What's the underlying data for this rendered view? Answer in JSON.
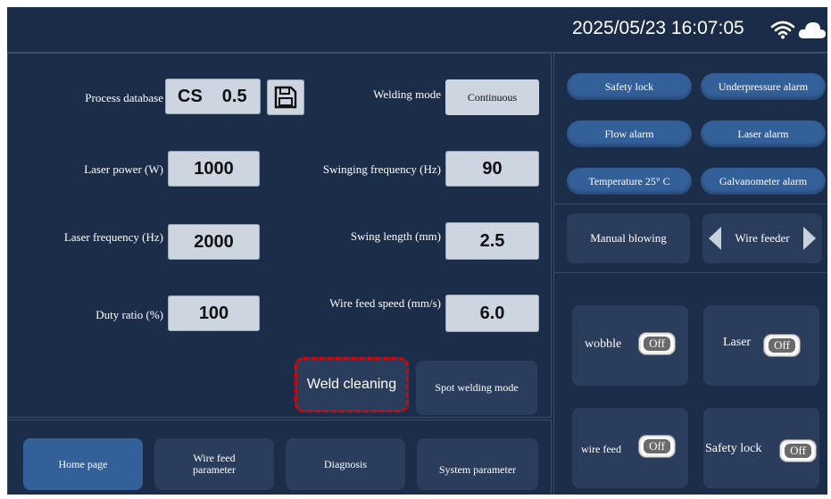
{
  "header": {
    "datetime": "2025/05/23 16:07:05",
    "wifi_icon": "wifi-icon",
    "cloud_icon": "cloud-icon"
  },
  "params": {
    "process_database": {
      "label": "Process database",
      "code": "CS",
      "value": "0.5"
    },
    "laser_power": {
      "label": "Laser power (W)",
      "value": "1000"
    },
    "laser_frequency": {
      "label": "Laser frequency (Hz)",
      "value": "2000"
    },
    "duty_ratio": {
      "label": "Duty ratio (%)",
      "value": "100"
    },
    "welding_mode": {
      "label": "Welding mode",
      "value": "Continuous"
    },
    "swinging_frequency": {
      "label": "Swinging frequency (Hz)",
      "value": "90"
    },
    "swing_length": {
      "label": "Swing length (mm)",
      "value": "2.5"
    },
    "wire_feed_speed": {
      "label": "Wire feed speed (mm/s)",
      "value": "6.0"
    }
  },
  "actions": {
    "weld_cleaning": "Weld cleaning",
    "spot_welding_mode": "Spot welding mode"
  },
  "alarms": {
    "safety_lock": "Safety lock",
    "underpressure": "Underpressure alarm",
    "flow": "Flow alarm",
    "laser": "Laser alarm",
    "temperature": "Temperature 25° C",
    "galvanometer": "Galvanometer alarm"
  },
  "controls": {
    "manual_blowing": "Manual blowing",
    "wire_feeder": "Wire feeder"
  },
  "toggles": {
    "wobble": {
      "label": "wobble",
      "state": "Off"
    },
    "laser": {
      "label": "Laser",
      "state": "Off"
    },
    "wire_feed": {
      "label": "wire feed",
      "state": "Off"
    },
    "safety_lock": {
      "label": "Safety lock",
      "state": "Off"
    }
  },
  "nav": {
    "home": "Home page",
    "wire_feed_parameter": "Wire feed parameter",
    "diagnosis": "Diagnosis",
    "system_parameter": "System parameter"
  },
  "colors": {
    "background": "#1a2c48",
    "alarm_pill": "#34609a",
    "highlight": "#e00000",
    "value_box": "#ccd5e0"
  }
}
